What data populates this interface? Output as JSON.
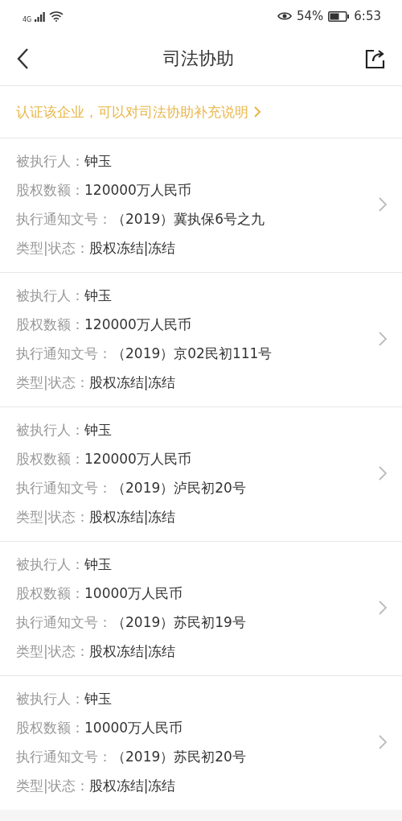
{
  "status_bar": {
    "network": "4G",
    "battery": "54%",
    "time": "6:53"
  },
  "header": {
    "title": "司法协助"
  },
  "banner": {
    "text": "认证该企业，可以对司法协助补充说明"
  },
  "records": [
    {
      "fields": [
        {
          "label": "被执行人：",
          "value": "钟玉"
        },
        {
          "label": "股权数额：",
          "value": "120000万人民币"
        },
        {
          "label": "执行通知文号：",
          "value": "（2019）冀执保6号之九"
        },
        {
          "label": "类型|状态：",
          "value": "股权冻结|冻结"
        }
      ]
    },
    {
      "fields": [
        {
          "label": "被执行人：",
          "value": "钟玉"
        },
        {
          "label": "股权数额：",
          "value": "120000万人民币"
        },
        {
          "label": "执行通知文号：",
          "value": "（2019）京02民初111号"
        },
        {
          "label": "类型|状态：",
          "value": "股权冻结|冻结"
        }
      ]
    },
    {
      "fields": [
        {
          "label": "被执行人：",
          "value": "钟玉"
        },
        {
          "label": "股权数额：",
          "value": "120000万人民币"
        },
        {
          "label": "执行通知文号：",
          "value": "（2019）泸民初20号"
        },
        {
          "label": "类型|状态：",
          "value": "股权冻结|冻结"
        }
      ]
    },
    {
      "fields": [
        {
          "label": "被执行人：",
          "value": "钟玉"
        },
        {
          "label": "股权数额：",
          "value": "10000万人民币"
        },
        {
          "label": "执行通知文号：",
          "value": "（2019）苏民初19号"
        },
        {
          "label": "类型|状态：",
          "value": "股权冻结|冻结"
        }
      ]
    },
    {
      "fields": [
        {
          "label": "被执行人：",
          "value": "钟玉"
        },
        {
          "label": "股权数额：",
          "value": "10000万人民币"
        },
        {
          "label": "执行通知文号：",
          "value": "（2019）苏民初20号"
        },
        {
          "label": "类型|状态：",
          "value": "股权冻结|冻结"
        }
      ]
    }
  ]
}
